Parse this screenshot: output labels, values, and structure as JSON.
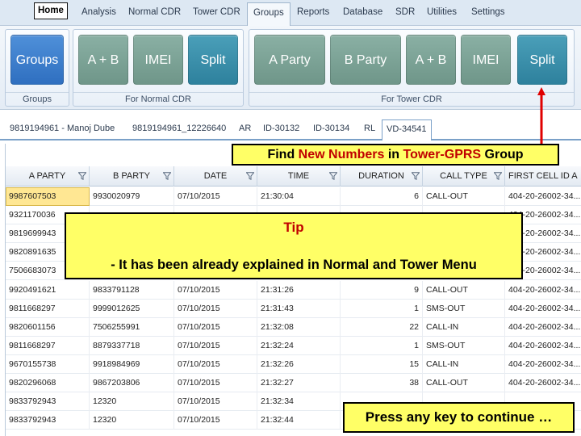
{
  "menu": {
    "items": [
      "Home",
      "Analysis",
      "Normal CDR",
      "Tower CDR",
      "Groups",
      "Reports",
      "Database",
      "SDR",
      "Utilities",
      "Settings"
    ],
    "active": "Groups"
  },
  "ribbon": {
    "groups_group": {
      "label": "Groups",
      "buttons": [
        "Groups"
      ]
    },
    "normal_group": {
      "label": "For Normal CDR",
      "buttons": [
        "A + B",
        "IMEI",
        "Split"
      ]
    },
    "tower_group": {
      "label": "For Tower CDR",
      "buttons": [
        "A Party",
        "B Party",
        "A + B",
        "IMEI",
        "Split"
      ]
    },
    "colors": {
      "blue": "#3a7fcf",
      "sage": "#7fa598",
      "teal": "#3b92ad"
    }
  },
  "doc_tabs": [
    "9819194961 - Manoj Dube",
    "9819194961_12226640",
    "AR",
    "ID-30132",
    "ID-30134",
    "RL",
    "VD-34541"
  ],
  "active_doc_tab": "VD-34541",
  "grid": {
    "columns": [
      "A PARTY",
      "B PARTY",
      "DATE",
      "TIME",
      "DURATION",
      "CALL TYPE",
      "FIRST CELL ID A"
    ],
    "rows": [
      [
        "9987607503",
        "9930020979",
        "07/10/2015",
        "21:30:04",
        "6",
        "CALL-OUT",
        "404-20-26002-34..."
      ],
      [
        "9321170036",
        "",
        "",
        "",
        "",
        "",
        "404-20-26002-34..."
      ],
      [
        "9819699943",
        "",
        "",
        "",
        "",
        "",
        "404-20-26002-34..."
      ],
      [
        "9820891635",
        "",
        "",
        "",
        "",
        "",
        "404-20-26002-34..."
      ],
      [
        "7506683073",
        "",
        "",
        "",
        "",
        "",
        "404-20-26002-34..."
      ],
      [
        "9920491621",
        "9833791128",
        "07/10/2015",
        "21:31:26",
        "9",
        "CALL-OUT",
        "404-20-26002-34..."
      ],
      [
        "9811668297",
        "9999012625",
        "07/10/2015",
        "21:31:43",
        "1",
        "SMS-OUT",
        "404-20-26002-34..."
      ],
      [
        "9820601156",
        "7506255991",
        "07/10/2015",
        "21:32:08",
        "22",
        "CALL-IN",
        "404-20-26002-34..."
      ],
      [
        "9811668297",
        "8879337718",
        "07/10/2015",
        "21:32:24",
        "1",
        "SMS-OUT",
        "404-20-26002-34..."
      ],
      [
        "9670155738",
        "9918984969",
        "07/10/2015",
        "21:32:26",
        "15",
        "CALL-IN",
        "404-20-26002-34..."
      ],
      [
        "9820296068",
        "9867203806",
        "07/10/2015",
        "21:32:27",
        "38",
        "CALL-OUT",
        "404-20-26002-34..."
      ],
      [
        "9833792943",
        "12320",
        "07/10/2015",
        "21:32:34",
        "",
        "",
        ""
      ],
      [
        "9833792943",
        "12320",
        "07/10/2015",
        "21:32:44",
        "",
        "",
        ""
      ]
    ]
  },
  "overlays": {
    "find_prefix": "Find ",
    "find_highlight1": "New Numbers",
    "find_middle": " in ",
    "find_highlight2": "Tower-GPRS",
    "find_suffix": " Group",
    "tip_title": "Tip",
    "tip_text": "- It has been already explained in Normal and Tower Menu",
    "continue_text": "Press any key to continue …",
    "highlight_color": "#ffff66",
    "accent_red": "#c00000"
  }
}
